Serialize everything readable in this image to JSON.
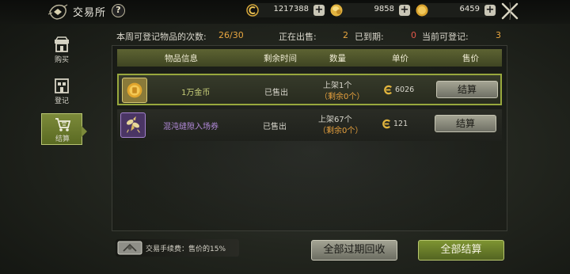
{
  "header": {
    "title": "交易所",
    "help_label": "?",
    "currencies": [
      {
        "icon": "bound-coin-icon",
        "value": "1217388"
      },
      {
        "icon": "gold-ingot-icon",
        "value": "9858"
      },
      {
        "icon": "gold-coin-icon",
        "value": "6459"
      }
    ],
    "add_label": "+"
  },
  "sidebar": {
    "items": [
      {
        "label": "购买",
        "icon": "shop-icon"
      },
      {
        "label": "登记",
        "icon": "register-icon"
      },
      {
        "label": "结算",
        "icon": "cart-icon",
        "active": true
      }
    ]
  },
  "stats": {
    "weekly_label": "本周可登记物品的次数:",
    "weekly_value": "26/30",
    "on_sale_label": "正在出售:",
    "on_sale_value": "2",
    "expired_label": "已到期:",
    "expired_value": "0",
    "available_label": "当前可登记:",
    "available_value": "3"
  },
  "table": {
    "columns": [
      "物品信息",
      "剩余时间",
      "数量",
      "单价",
      "售价"
    ],
    "rows": [
      {
        "name": "1万金币",
        "name_color": "#c9d07a",
        "icon": "gold-coin-item-icon",
        "status": "已售出",
        "qty_listed": "上架1个",
        "qty_remaining": "（剩余0个）",
        "price": "6026",
        "button": "结算",
        "selected": true
      },
      {
        "name": "混沌缝隙入场券",
        "name_color": "#b28ad9",
        "icon": "fairy-ticket-icon",
        "status": "已售出",
        "qty_listed": "上架67个",
        "qty_remaining": "（剩余0个）",
        "price": "121",
        "button": "结算",
        "selected": false
      }
    ]
  },
  "footer": {
    "fee_text": "交易手续费：售价的15%",
    "reclaim_label": "全部过期回收",
    "settle_all_label": "全部结算"
  }
}
